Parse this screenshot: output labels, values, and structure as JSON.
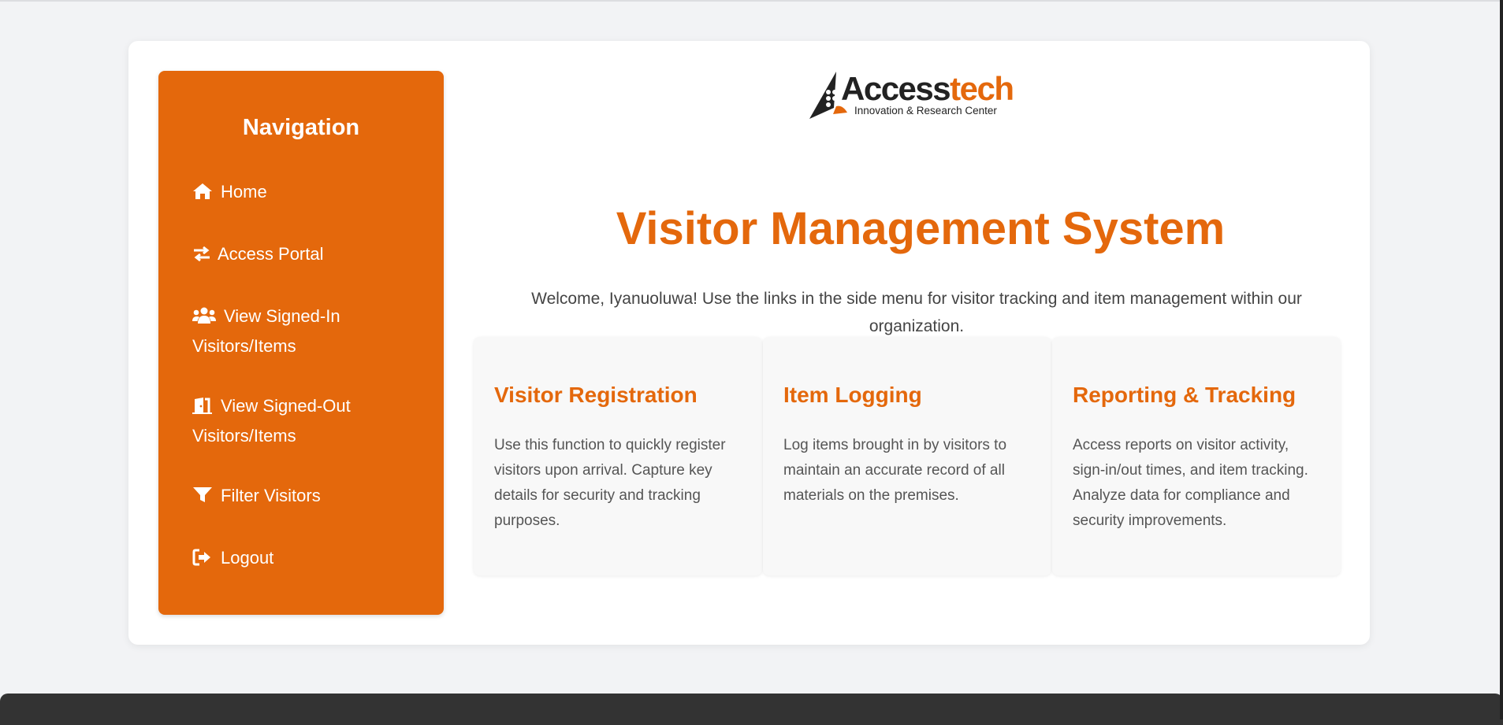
{
  "colors": {
    "accent": "#e4680c",
    "background": "#f2f3f5",
    "footer": "#333333"
  },
  "logo": {
    "part1": "Access",
    "part2": "tech",
    "tagline": "Innovation & Research Center"
  },
  "nav": {
    "title": "Navigation",
    "items": [
      {
        "label": "Home",
        "icon": "home-icon"
      },
      {
        "label": "Access Portal",
        "icon": "swap-arrows-icon"
      },
      {
        "label": "View Signed-In Visitors/Items",
        "icon": "users-icon"
      },
      {
        "label": "View Signed-Out Visitors/Items",
        "icon": "door-exit-icon"
      },
      {
        "label": "Filter Visitors",
        "icon": "filter-icon"
      },
      {
        "label": "Logout",
        "icon": "logout-icon"
      }
    ]
  },
  "main": {
    "title": "Visitor Management System",
    "welcome": "Welcome, Iyanuoluwa! Use the links in the side menu for visitor tracking and item management within our organization."
  },
  "features": [
    {
      "title": "Visitor Registration",
      "text": "Use this function to quickly register visitors upon arrival. Capture key details for security and tracking purposes."
    },
    {
      "title": "Item Logging",
      "text": "Log items brought in by visitors to maintain an accurate record of all materials on the premises."
    },
    {
      "title": "Reporting & Tracking",
      "text": "Access reports on visitor activity, sign-in/out times, and item tracking. Analyze data for compliance and security improvements."
    }
  ]
}
